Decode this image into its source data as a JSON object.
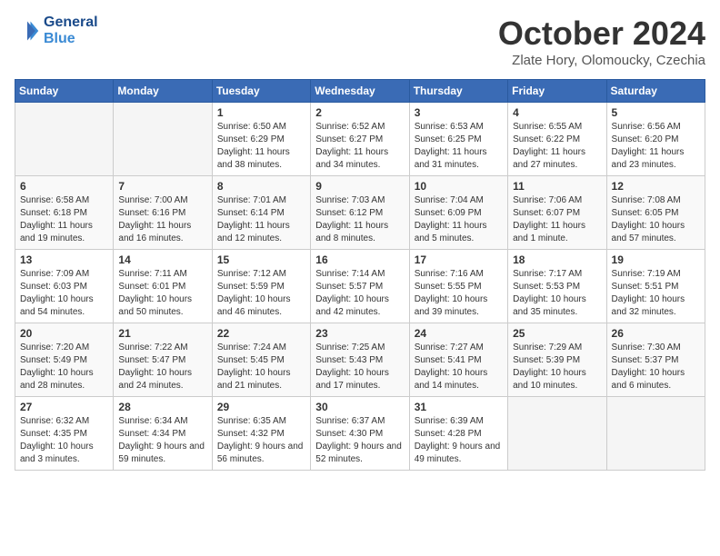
{
  "header": {
    "logo_general": "General",
    "logo_blue": "Blue",
    "month": "October 2024",
    "location": "Zlate Hory, Olomoucky, Czechia"
  },
  "weekdays": [
    "Sunday",
    "Monday",
    "Tuesday",
    "Wednesday",
    "Thursday",
    "Friday",
    "Saturday"
  ],
  "weeks": [
    [
      {
        "day": "",
        "info": ""
      },
      {
        "day": "",
        "info": ""
      },
      {
        "day": "1",
        "info": "Sunrise: 6:50 AM\nSunset: 6:29 PM\nDaylight: 11 hours and 38 minutes."
      },
      {
        "day": "2",
        "info": "Sunrise: 6:52 AM\nSunset: 6:27 PM\nDaylight: 11 hours and 34 minutes."
      },
      {
        "day": "3",
        "info": "Sunrise: 6:53 AM\nSunset: 6:25 PM\nDaylight: 11 hours and 31 minutes."
      },
      {
        "day": "4",
        "info": "Sunrise: 6:55 AM\nSunset: 6:22 PM\nDaylight: 11 hours and 27 minutes."
      },
      {
        "day": "5",
        "info": "Sunrise: 6:56 AM\nSunset: 6:20 PM\nDaylight: 11 hours and 23 minutes."
      }
    ],
    [
      {
        "day": "6",
        "info": "Sunrise: 6:58 AM\nSunset: 6:18 PM\nDaylight: 11 hours and 19 minutes."
      },
      {
        "day": "7",
        "info": "Sunrise: 7:00 AM\nSunset: 6:16 PM\nDaylight: 11 hours and 16 minutes."
      },
      {
        "day": "8",
        "info": "Sunrise: 7:01 AM\nSunset: 6:14 PM\nDaylight: 11 hours and 12 minutes."
      },
      {
        "day": "9",
        "info": "Sunrise: 7:03 AM\nSunset: 6:12 PM\nDaylight: 11 hours and 8 minutes."
      },
      {
        "day": "10",
        "info": "Sunrise: 7:04 AM\nSunset: 6:09 PM\nDaylight: 11 hours and 5 minutes."
      },
      {
        "day": "11",
        "info": "Sunrise: 7:06 AM\nSunset: 6:07 PM\nDaylight: 11 hours and 1 minute."
      },
      {
        "day": "12",
        "info": "Sunrise: 7:08 AM\nSunset: 6:05 PM\nDaylight: 10 hours and 57 minutes."
      }
    ],
    [
      {
        "day": "13",
        "info": "Sunrise: 7:09 AM\nSunset: 6:03 PM\nDaylight: 10 hours and 54 minutes."
      },
      {
        "day": "14",
        "info": "Sunrise: 7:11 AM\nSunset: 6:01 PM\nDaylight: 10 hours and 50 minutes."
      },
      {
        "day": "15",
        "info": "Sunrise: 7:12 AM\nSunset: 5:59 PM\nDaylight: 10 hours and 46 minutes."
      },
      {
        "day": "16",
        "info": "Sunrise: 7:14 AM\nSunset: 5:57 PM\nDaylight: 10 hours and 42 minutes."
      },
      {
        "day": "17",
        "info": "Sunrise: 7:16 AM\nSunset: 5:55 PM\nDaylight: 10 hours and 39 minutes."
      },
      {
        "day": "18",
        "info": "Sunrise: 7:17 AM\nSunset: 5:53 PM\nDaylight: 10 hours and 35 minutes."
      },
      {
        "day": "19",
        "info": "Sunrise: 7:19 AM\nSunset: 5:51 PM\nDaylight: 10 hours and 32 minutes."
      }
    ],
    [
      {
        "day": "20",
        "info": "Sunrise: 7:20 AM\nSunset: 5:49 PM\nDaylight: 10 hours and 28 minutes."
      },
      {
        "day": "21",
        "info": "Sunrise: 7:22 AM\nSunset: 5:47 PM\nDaylight: 10 hours and 24 minutes."
      },
      {
        "day": "22",
        "info": "Sunrise: 7:24 AM\nSunset: 5:45 PM\nDaylight: 10 hours and 21 minutes."
      },
      {
        "day": "23",
        "info": "Sunrise: 7:25 AM\nSunset: 5:43 PM\nDaylight: 10 hours and 17 minutes."
      },
      {
        "day": "24",
        "info": "Sunrise: 7:27 AM\nSunset: 5:41 PM\nDaylight: 10 hours and 14 minutes."
      },
      {
        "day": "25",
        "info": "Sunrise: 7:29 AM\nSunset: 5:39 PM\nDaylight: 10 hours and 10 minutes."
      },
      {
        "day": "26",
        "info": "Sunrise: 7:30 AM\nSunset: 5:37 PM\nDaylight: 10 hours and 6 minutes."
      }
    ],
    [
      {
        "day": "27",
        "info": "Sunrise: 6:32 AM\nSunset: 4:35 PM\nDaylight: 10 hours and 3 minutes."
      },
      {
        "day": "28",
        "info": "Sunrise: 6:34 AM\nSunset: 4:34 PM\nDaylight: 9 hours and 59 minutes."
      },
      {
        "day": "29",
        "info": "Sunrise: 6:35 AM\nSunset: 4:32 PM\nDaylight: 9 hours and 56 minutes."
      },
      {
        "day": "30",
        "info": "Sunrise: 6:37 AM\nSunset: 4:30 PM\nDaylight: 9 hours and 52 minutes."
      },
      {
        "day": "31",
        "info": "Sunrise: 6:39 AM\nSunset: 4:28 PM\nDaylight: 9 hours and 49 minutes."
      },
      {
        "day": "",
        "info": ""
      },
      {
        "day": "",
        "info": ""
      }
    ]
  ]
}
